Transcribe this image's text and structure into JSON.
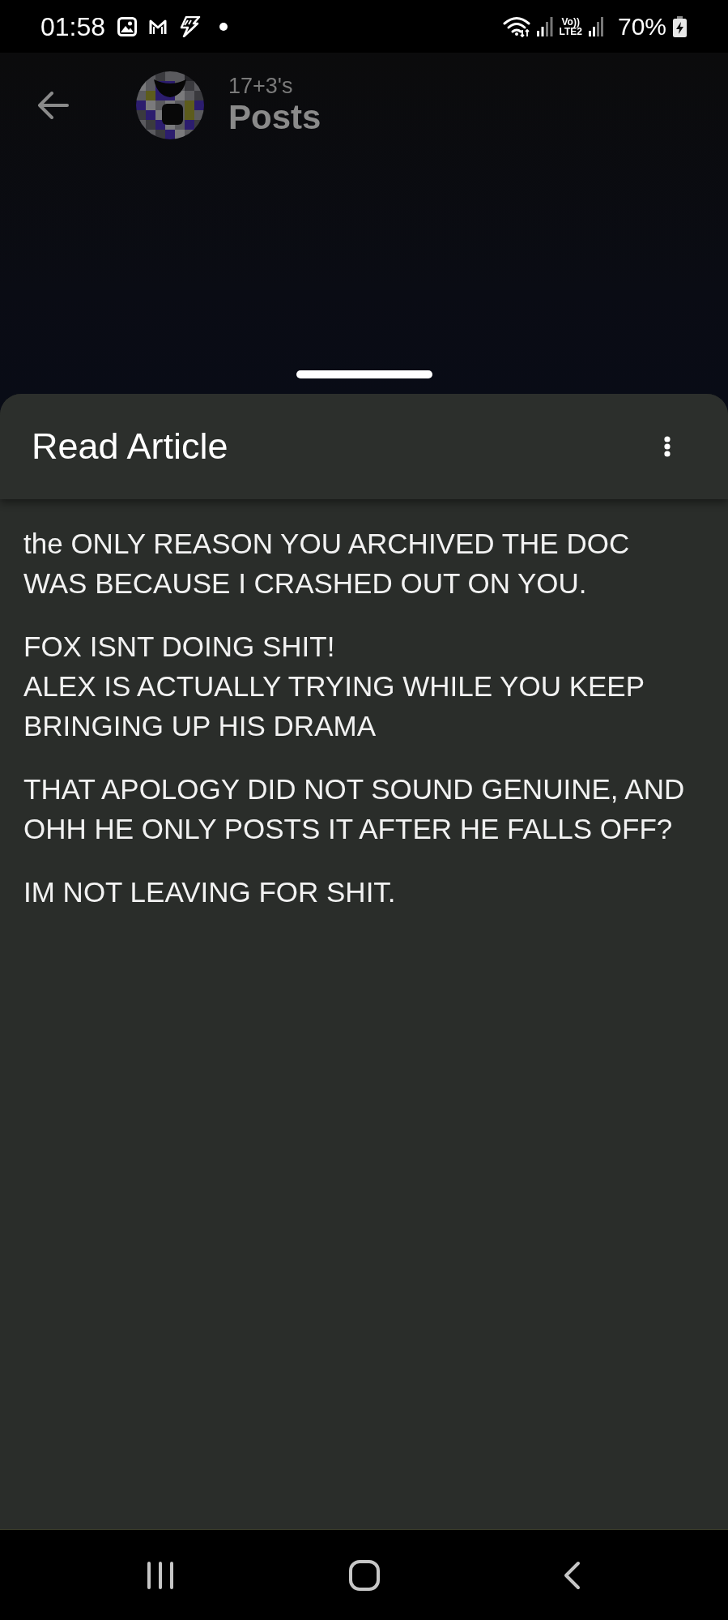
{
  "status_bar": {
    "time": "01:58",
    "volte": "Vo))",
    "network": "LTE2",
    "battery": "70%",
    "charging": true
  },
  "header": {
    "owner": "17+3's",
    "title": "Posts"
  },
  "sheet": {
    "title": "Read Article",
    "paragraphs": [
      "the ONLY REASON YOU ARCHIVED THE DOC\nWAS BECAUSE I CRASHED OUT ON YOU.",
      "FOX ISNT DOING SHIT!\nALEX IS ACTUALLY TRYING WHILE YOU KEEP\nBRINGING UP HIS DRAMA",
      "THAT APOLOGY DID NOT SOUND GENUINE, AND\nOHH HE ONLY POSTS IT AFTER HE FALLS OFF?",
      "IM NOT LEAVING FOR SHIT."
    ]
  }
}
